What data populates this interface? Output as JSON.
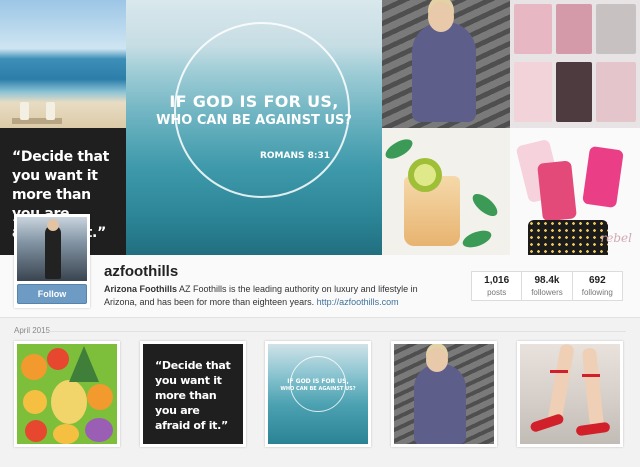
{
  "mosaic": {
    "quote_text": "“Decide that you want it more than you are afraid of it.”",
    "god_line1": "IF GOD IS FOR US,",
    "god_line2": "WHO CAN BE AGAINST US?",
    "god_ref": "ROMANS 8:31",
    "signature": "rebel"
  },
  "profile": {
    "username": "azfoothills",
    "follow_label": "Follow",
    "bio_name": "Arizona Foothills",
    "bio_text": " AZ Foothills is the leading authority on luxury and lifestyle in Arizona, and has been for more than eighteen years. ",
    "bio_link": "http://azfoothills.com",
    "stats": [
      {
        "value": "1,016",
        "label": "posts"
      },
      {
        "value": "98.4k",
        "label": "followers"
      },
      {
        "value": "692",
        "label": "following"
      }
    ]
  },
  "feed": {
    "month_label": "April 2015",
    "posts": [
      {
        "subject": "fruit-platter"
      },
      {
        "subject": "quote",
        "text": "“Decide that you want it more than you are afraid of it.”"
      },
      {
        "subject": "god-quote",
        "line1": "IF GOD IS FOR US,",
        "line2": "WHO CAN BE AGAINST US?"
      },
      {
        "subject": "runner"
      },
      {
        "subject": "red-heels"
      }
    ]
  },
  "colors": {
    "follow_button": "#6d9bc3",
    "link": "#3f729b",
    "background": "#f2f2f2"
  }
}
